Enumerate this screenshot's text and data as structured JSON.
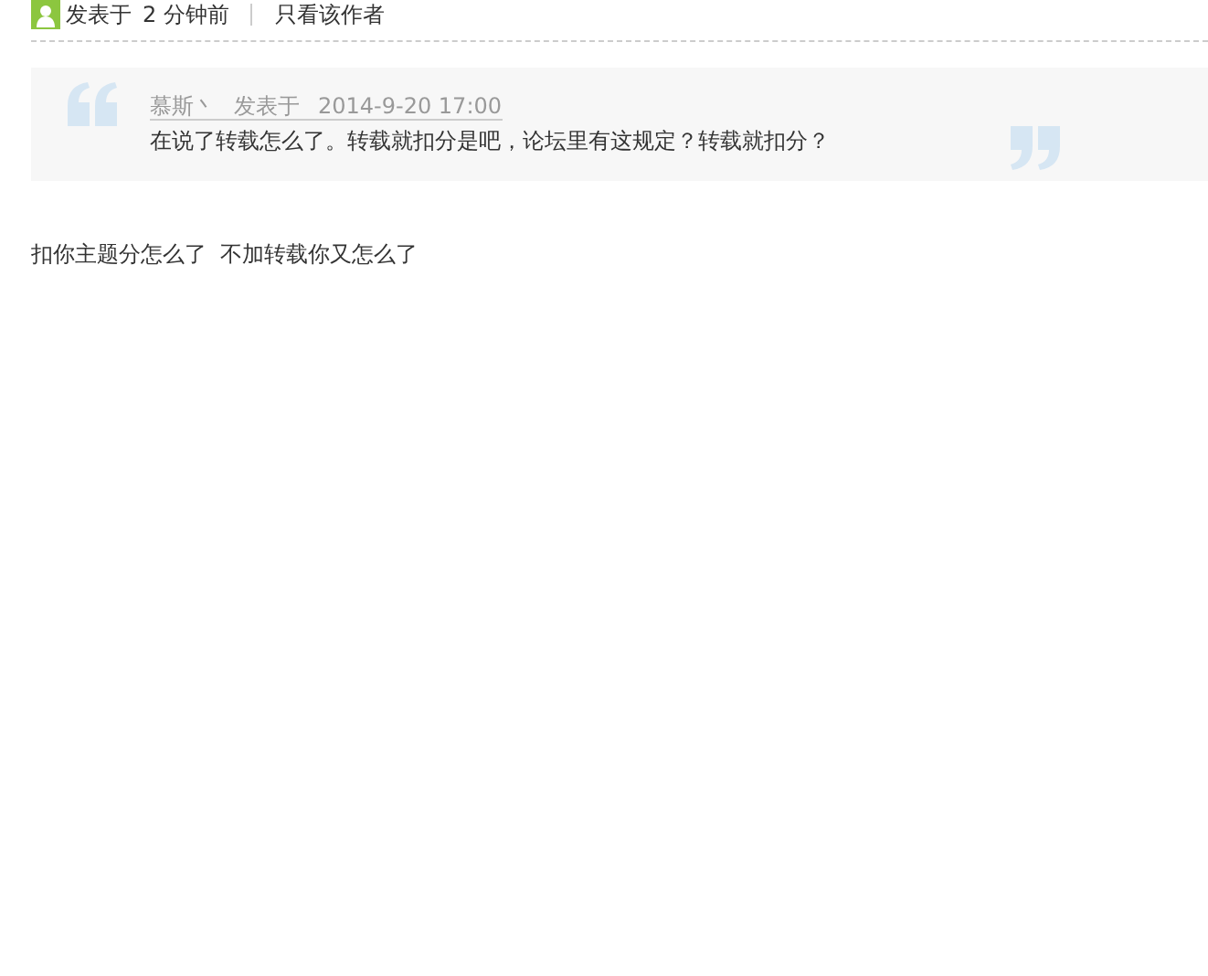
{
  "post_meta": {
    "posted_label": "发表于",
    "time": "2 分钟前",
    "author_only_link": "只看该作者"
  },
  "quote": {
    "author": "慕斯丶",
    "posted_label": "发表于",
    "date": "2014-9-20 17:00",
    "text": "在说了转载怎么了。转载就扣分是吧，论坛里有这规定？转载就扣分？"
  },
  "reply": {
    "text": "扣你主题分怎么了  不加转载你又怎么了"
  }
}
